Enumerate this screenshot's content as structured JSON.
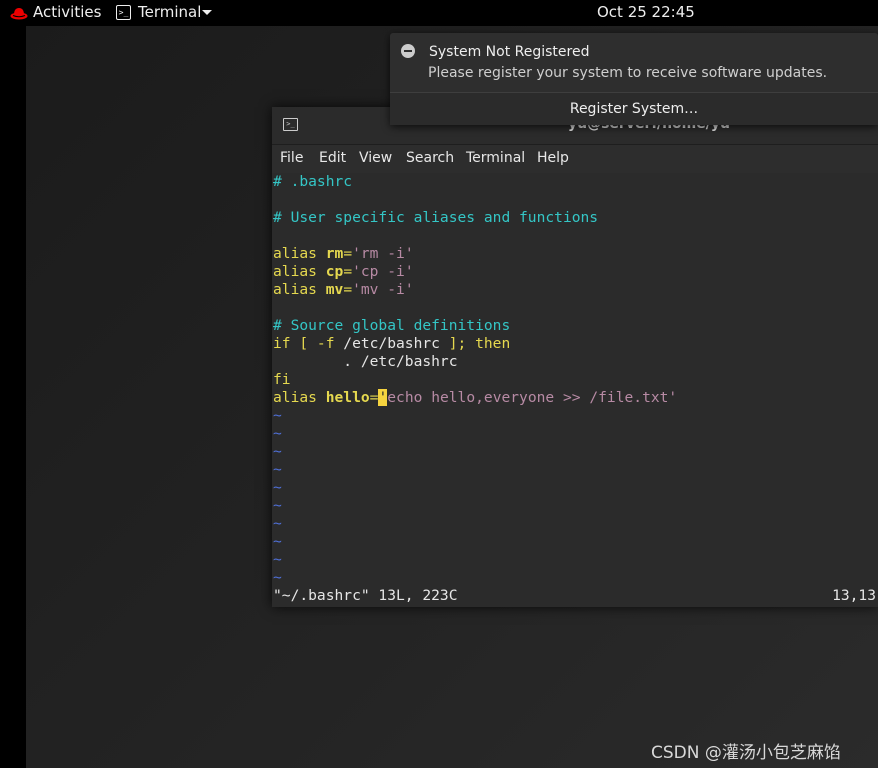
{
  "topbar": {
    "activities": "Activities",
    "app_name": "Terminal",
    "clock": "Oct 25  22:45",
    "brand_color": "#ee0000"
  },
  "notification": {
    "title": "System Not Registered",
    "body": "Please register your system to receive software updates.",
    "action": "Register System…"
  },
  "window": {
    "title": "yu@server:/home/yu",
    "menu": [
      "File",
      "Edit",
      "View",
      "Search",
      "Terminal",
      "Help"
    ]
  },
  "editor": {
    "line1": "# .bashrc",
    "line3": "# User specific aliases and functions",
    "alias_kw": "alias",
    "rm_name": "rm",
    "rm_val": "'rm -i'",
    "cp_name": "cp",
    "cp_val": "'cp -i'",
    "mv_name": "mv",
    "mv_val": "'mv -i'",
    "line9": "# Source global definitions",
    "if_kw": "if",
    "if_open": " [ -f ",
    "if_path": "/etc/bashrc",
    "if_close": " ]; ",
    "then_kw": "then",
    "source_line": "        . /etc/bashrc",
    "fi_kw": "fi",
    "hello_name": "hello",
    "equals": "=",
    "cursor_char": "'",
    "hello_val": "echo hello,everyone >> /file.txt'",
    "tilde": "~",
    "status_left": "\"~/.bashrc\" 13L, 223C",
    "status_right": "13,13"
  },
  "watermark": "CSDN @灌汤小包芝麻馅",
  "colors": {
    "comment": "#34c6c6",
    "keyword": "#e5d84f",
    "string": "#b78aa4",
    "tilde": "#4f6fd6",
    "cursor": "#f5d33f"
  }
}
